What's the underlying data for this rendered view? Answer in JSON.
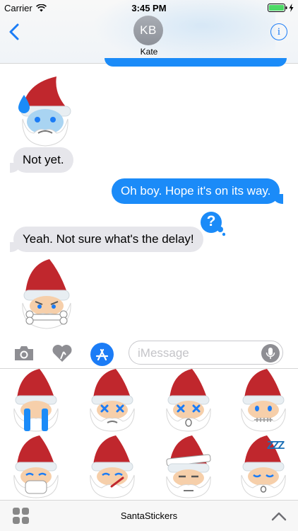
{
  "status_bar": {
    "carrier": "Carrier",
    "time": "3:45 PM"
  },
  "header": {
    "avatar_initials": "KB",
    "contact_name": "Kate"
  },
  "messages": [
    {
      "from": "contact",
      "text": "Not yet."
    },
    {
      "from": "me",
      "text": "Oh boy. Hope it's on its way."
    },
    {
      "from": "contact",
      "text": "Yeah. Not sure what's the delay!"
    }
  ],
  "question_badge": "?",
  "stickers_in_thread": [
    "santa-sweating-sticker",
    "santa-bone-mouth-sticker"
  ],
  "input": {
    "placeholder": "iMessage"
  },
  "drawer": {
    "stickers": [
      "santa-crying-sticker",
      "santa-x-eyes-sticker",
      "santa-x-eyes-shocked-sticker",
      "santa-zipped-mouth-sticker",
      "santa-mask-sticker",
      "santa-thermometer-sticker",
      "santa-bandaged-sticker",
      "santa-sleeping-sticker"
    ],
    "sleep_text": "ZZZ"
  },
  "bottom_bar": {
    "title": "SantaStickers"
  },
  "colors": {
    "accent": "#1b7cf6",
    "outgoing_bubble": "#1b8bf8",
    "incoming_bubble": "#e6e6eb",
    "santa_hat": "#c0272d"
  }
}
